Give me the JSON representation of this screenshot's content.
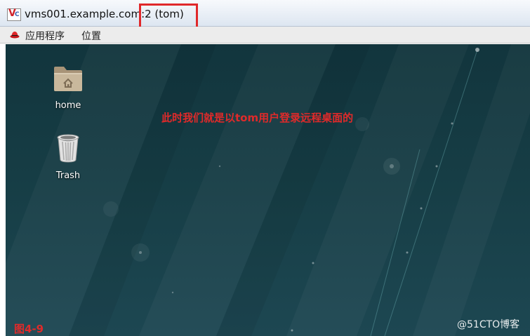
{
  "window": {
    "title": "vms001.example.com:2 (tom)",
    "app_icon_letters": "VC"
  },
  "menubar": {
    "items": [
      {
        "label": "应用程序"
      },
      {
        "label": "位置"
      }
    ]
  },
  "desktop": {
    "icons": [
      {
        "label": "home",
        "icon": "home-folder-icon"
      },
      {
        "label": "Trash",
        "icon": "trash-icon"
      }
    ]
  },
  "annotations": {
    "note": "此时我们就是以tom用户登录远程桌面的",
    "figure_label": "图4-9",
    "highlight_color": "#e0282a"
  },
  "watermark": "@51CTO博客"
}
